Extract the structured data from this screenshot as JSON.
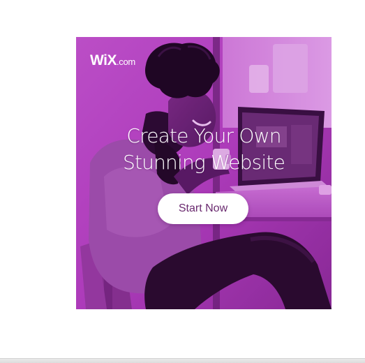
{
  "ad": {
    "logo": {
      "brand": "WiX",
      "suffix": ".com"
    },
    "headline_line1": "Create Your Own",
    "headline_line2": "Stunning Website",
    "cta_label": "Start Now",
    "colors": {
      "overlay": "#b83dc4",
      "dark": "#2a0a2e",
      "cta_text": "#6a2a6f",
      "cta_bg": "#ffffff"
    }
  }
}
